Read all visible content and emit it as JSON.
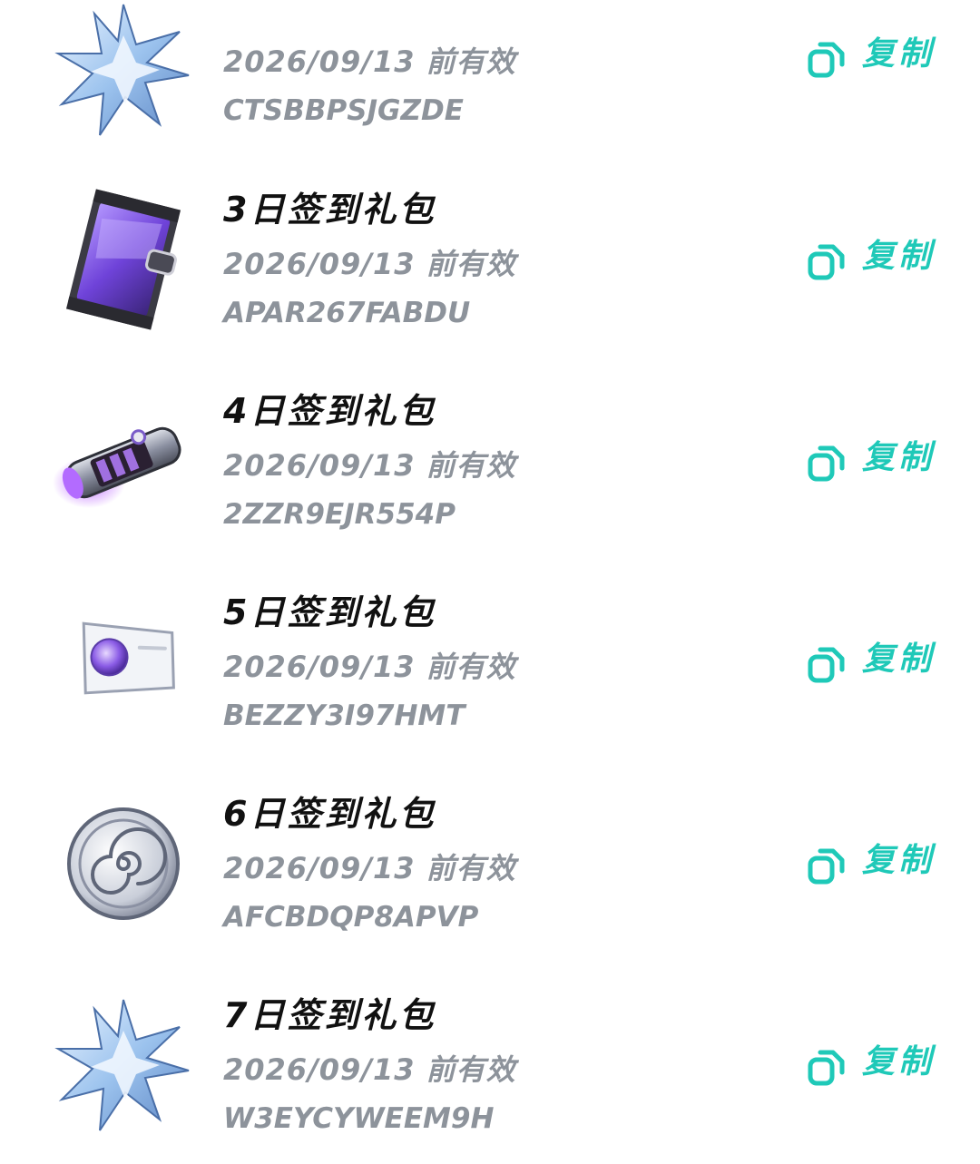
{
  "items": [
    {
      "title": "",
      "expiry": "2026/09/13 前有效",
      "code": "CTSBBPSJGZDE",
      "copy_label": "复制",
      "icon": "crystal-star-icon"
    },
    {
      "title": "3日签到礼包",
      "expiry": "2026/09/13 前有效",
      "code": "APAR267FABDU",
      "copy_label": "复制",
      "icon": "purple-bag-icon"
    },
    {
      "title": "4日签到礼包",
      "expiry": "2026/09/13 前有效",
      "code": "2ZZR9EJR554P",
      "copy_label": "复制",
      "icon": "energy-tube-icon"
    },
    {
      "title": "5日签到礼包",
      "expiry": "2026/09/13 前有效",
      "code": "BEZZY3I97HMT",
      "copy_label": "复制",
      "icon": "gem-ticket-icon"
    },
    {
      "title": "6日签到礼包",
      "expiry": "2026/09/13 前有效",
      "code": "AFCBDQP8APVP",
      "copy_label": "复制",
      "icon": "spiral-coin-icon"
    },
    {
      "title": "7日签到礼包",
      "expiry": "2026/09/13 前有效",
      "code": "W3EYCYWEEM9H",
      "copy_label": "复制",
      "icon": "crystal-star-icon"
    }
  ],
  "colors": {
    "accent": "#1fc9b8",
    "title": "#111111",
    "secondary": "#8d939b"
  }
}
